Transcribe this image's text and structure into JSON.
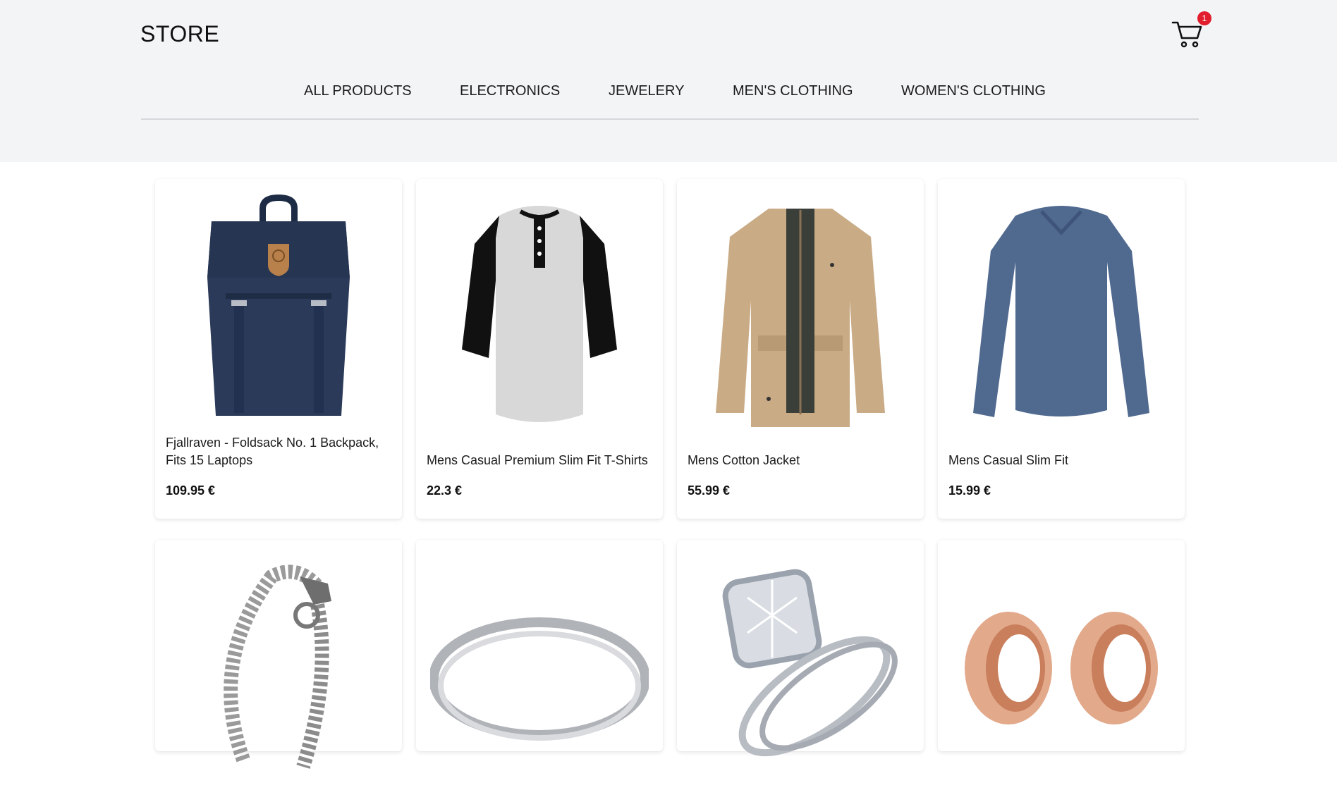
{
  "brand": "STORE",
  "cart": {
    "count": "1",
    "icon": "cart-icon",
    "badge_color": "#e11d2e"
  },
  "nav": {
    "items": [
      "ALL PRODUCTS",
      "ELECTRONICS",
      "JEWELERY",
      "MEN'S CLOTHING",
      "WOMEN'S CLOTHING"
    ]
  },
  "products": [
    {
      "title": "Fjallraven - Foldsack No. 1 Backpack, Fits 15 Laptops",
      "price": "109.95 €",
      "image": "backpack-image"
    },
    {
      "title": "Mens Casual Premium Slim Fit T-Shirts",
      "price": "22.3 €",
      "image": "tshirt-image"
    },
    {
      "title": "Mens Cotton Jacket",
      "price": "55.99 €",
      "image": "jacket-image"
    },
    {
      "title": "Mens Casual Slim Fit",
      "price": "15.99 €",
      "image": "longsleeve-image"
    },
    {
      "title": "",
      "price": "",
      "image": "bracelet-image"
    },
    {
      "title": "",
      "price": "",
      "image": "ring-image"
    },
    {
      "title": "",
      "price": "",
      "image": "diamond-ring-image"
    },
    {
      "title": "",
      "price": "",
      "image": "earring-plugs-image"
    }
  ],
  "colors": {
    "header_bg": "#f3f4f6",
    "divider": "#d6d7da",
    "accent": "#e11d2e"
  }
}
